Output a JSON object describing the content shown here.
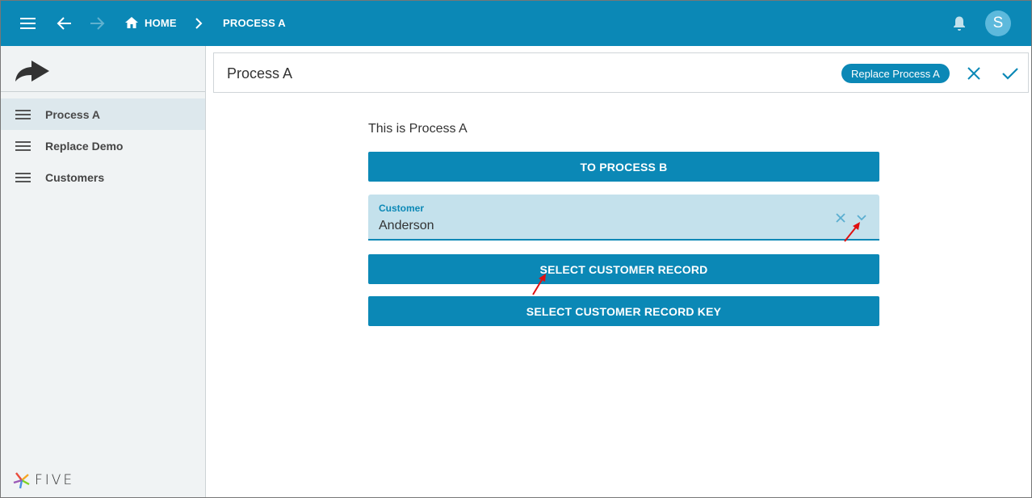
{
  "topbar": {
    "breadcrumb_home": "HOME",
    "breadcrumb_current": "PROCESS A",
    "avatar_initial": "S",
    "icons": [
      "menu-icon",
      "arrow-left-icon",
      "arrow-right-icon",
      "home-icon",
      "chevron-right-icon",
      "bell-icon"
    ]
  },
  "sidebar": {
    "items": [
      {
        "label": "Process A",
        "active": true
      },
      {
        "label": "Replace Demo",
        "active": false
      },
      {
        "label": "Customers",
        "active": false
      }
    ],
    "footer_logo_text": "FIVE"
  },
  "form": {
    "title": "Process A",
    "replace_chip": "Replace Process A",
    "intro_text": "This is Process A",
    "to_process_b": "TO PROCESS B",
    "customer_field": {
      "label": "Customer",
      "value": "Anderson"
    },
    "select_record": "SELECT CUSTOMER RECORD",
    "select_record_key": "SELECT CUSTOMER RECORD KEY"
  },
  "colors": {
    "primary": "#0b88b6",
    "field_bg": "#c4e1ec",
    "sidebar_bg": "#f0f3f4",
    "annotation": "#e01010"
  }
}
